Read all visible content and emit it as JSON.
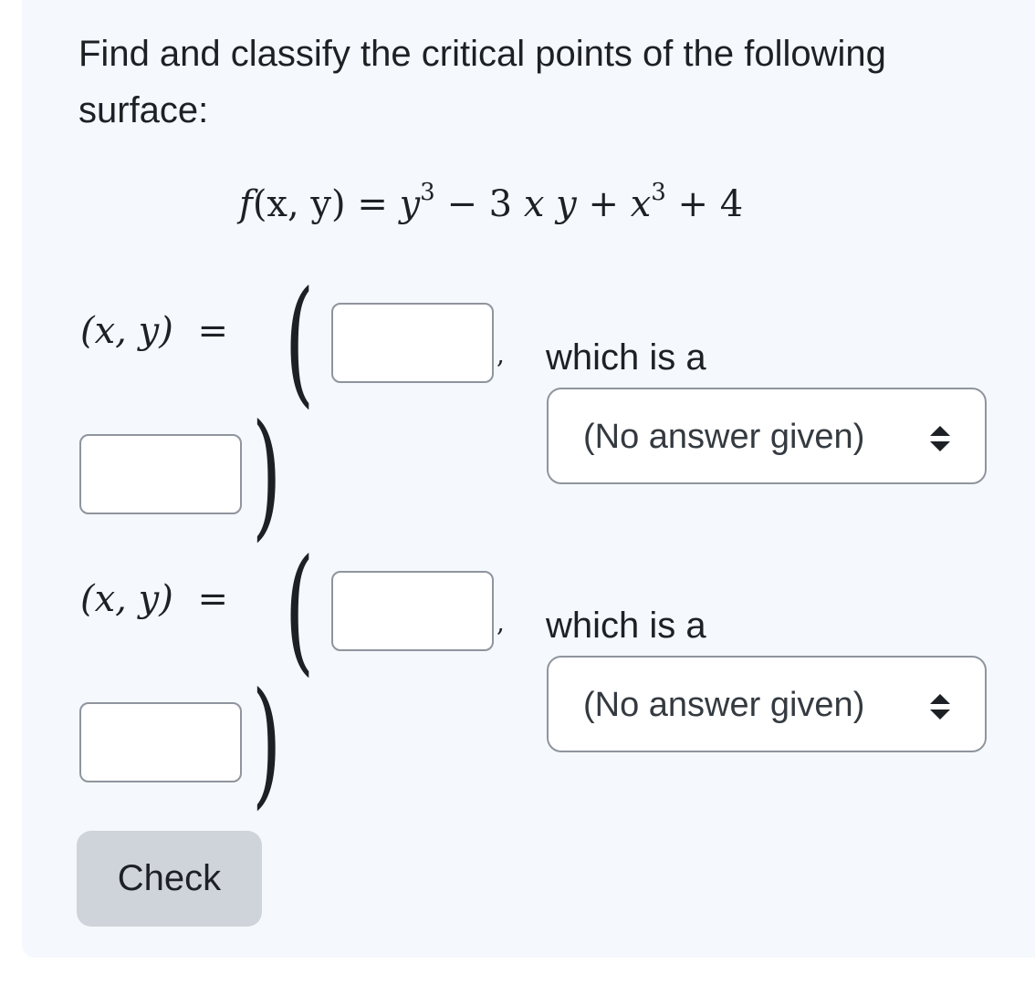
{
  "question": {
    "text": "Find and classify the critical points of the following surface:"
  },
  "formula": {
    "lhs": "f",
    "args": "(x, y)",
    "equals": "=",
    "y_term": "y",
    "exp1": "3",
    "minus": "−",
    "coef": "3",
    "x_var": "x",
    "y_var": "y",
    "plus1": "+",
    "x_term": "x",
    "exp2": "3",
    "plus2": "+",
    "const": "4"
  },
  "points": [
    {
      "lhs": "(x, y)",
      "equals": "=",
      "open_paren": "(",
      "close_paren": ")",
      "comma": ",",
      "x_value": "",
      "y_value": "",
      "which_text": "which is a",
      "classification": "(No answer given)"
    },
    {
      "lhs": "(x, y)",
      "equals": "=",
      "open_paren": "(",
      "close_paren": ")",
      "comma": ",",
      "x_value": "",
      "y_value": "",
      "which_text": "which is a",
      "classification": "(No answer given)"
    }
  ],
  "icons": {
    "select_arrows": "updown-arrows-icon"
  },
  "check_button": {
    "label": "Check"
  },
  "colors": {
    "card_background": "#f5f8fc",
    "button_background": "#ced4da",
    "input_border": "#8f959e"
  }
}
